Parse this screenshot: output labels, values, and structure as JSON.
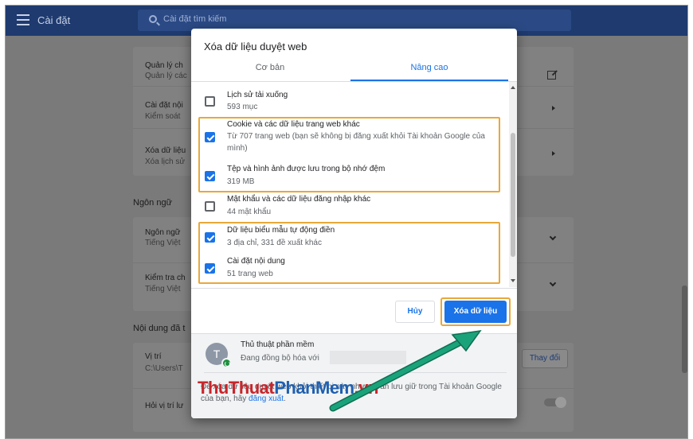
{
  "settings": {
    "title": "Cài đặt",
    "search_placeholder": "Cài đặt tìm kiếm",
    "rows": [
      {
        "title": "Quản lý ch",
        "sub": "Quản lý các"
      },
      {
        "title": "Cài đặt nội",
        "sub": "Kiểm soát"
      },
      {
        "title": "Xóa dữ liệu",
        "sub": "Xóa lịch sử"
      }
    ],
    "language_section": "Ngôn ngữ",
    "language_rows": [
      {
        "title": "Ngôn ngữ",
        "sub": "Tiếng Việt"
      },
      {
        "title": "Kiểm tra ch",
        "sub": "Tiếng Việt"
      }
    ],
    "downloads_section": "Nội dung đã t",
    "downloads_rows": [
      {
        "title": "Vị trí",
        "sub": "C:\\Users\\T"
      },
      {
        "title": "Hỏi vị trí lư",
        "sub": ""
      }
    ],
    "change_label": "Thay đổi"
  },
  "dialog": {
    "title": "Xóa dữ liệu duyệt web",
    "tabs": [
      "Cơ bản",
      "Nâng cao"
    ],
    "active_tab": "Nâng cao",
    "options": [
      {
        "title": "Lịch sử tải xuống",
        "sub": "593 mục",
        "checked": false
      },
      {
        "title": "Cookie và các dữ liệu trang web khác",
        "sub": "Từ 707 trang web (bạn sẽ không bị đăng xuất khỏi Tài khoản Google của mình)",
        "checked": true
      },
      {
        "title": "Tệp và hình ảnh được lưu trong bộ nhớ đệm",
        "sub": "319 MB",
        "checked": true
      },
      {
        "title": "Mật khẩu và các dữ liệu đăng nhập khác",
        "sub": "44 mật khẩu",
        "checked": false
      },
      {
        "title": "Dữ liệu biểu mẫu tự động điền",
        "sub": "3 địa chỉ, 331 đề xuất khác",
        "checked": true
      },
      {
        "title": "Cài đặt nội dung",
        "sub": "51 trang web",
        "checked": true
      }
    ],
    "cancel_label": "Hủy",
    "clear_label": "Xóa dữ liệu",
    "account": {
      "initial": "T",
      "name": "Thủ thuật phần mềm",
      "sync_text": "Đang đồng bộ hóa với"
    },
    "footer_note_pre": "Để xóa dữ liệu duyệt web khỏi thiết bị này nhưng vẫn lưu giữ trong Tài khoản Google của bạn, hãy ",
    "footer_link": "đăng xuất",
    "footer_note_post": "."
  },
  "watermark": {
    "part1": "ThuThuat",
    "part2": "PhanMem",
    "part3": ".vn"
  },
  "colors": {
    "accent": "#1a73e8",
    "highlight": "#e8a83a",
    "arrow": "#1aa37a",
    "topbar": "#1e3a6e"
  }
}
